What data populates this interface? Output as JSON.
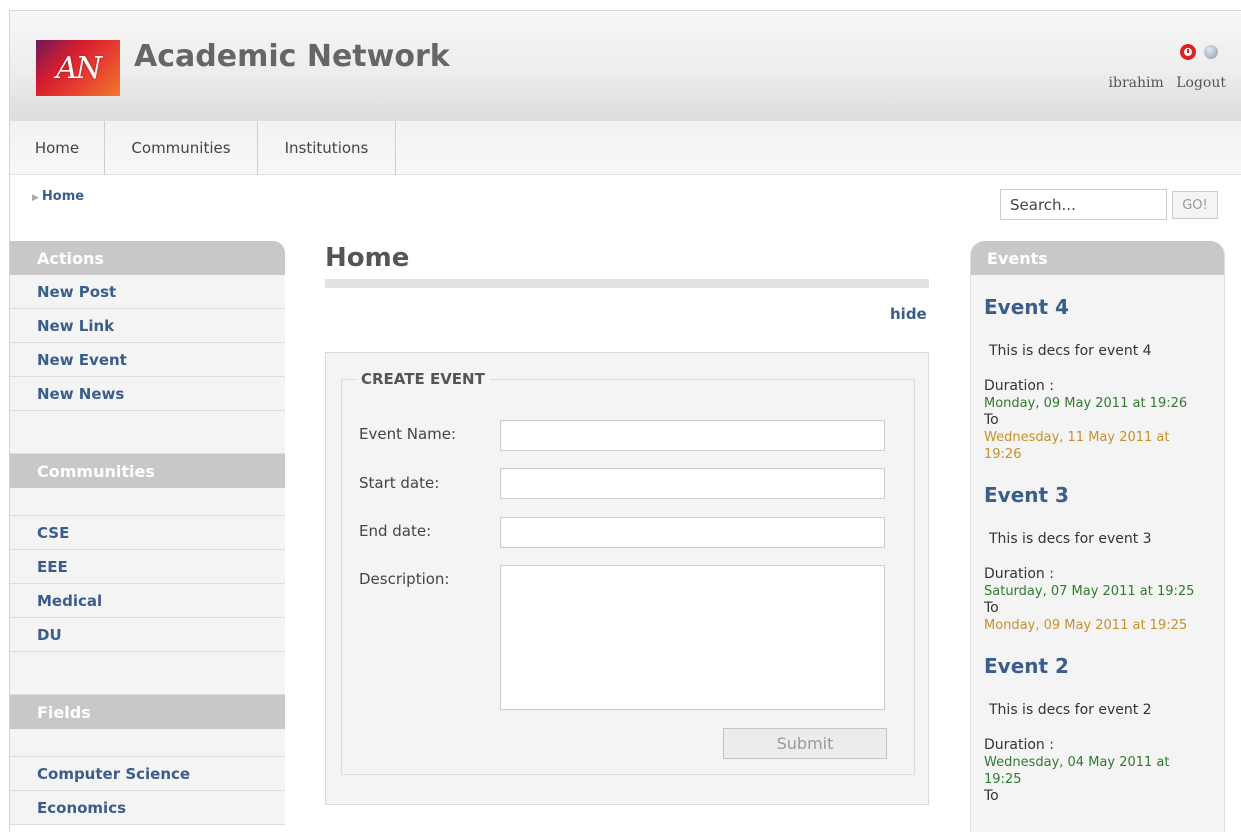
{
  "header": {
    "logo_text": "AN",
    "site_title": "Academic Network",
    "username": "ibrahim",
    "logout_label": "Logout"
  },
  "nav": [
    "Home",
    "Communities",
    "Institutions"
  ],
  "breadcrumb": {
    "current": "Home"
  },
  "search": {
    "placeholder": "Search...",
    "go_label": "GO!"
  },
  "sidebar": {
    "actions_title": "Actions",
    "actions": [
      "New Post",
      "New Link",
      "New Event",
      "New News"
    ],
    "communities_title": "Communities",
    "communities": [
      "CSE",
      "EEE",
      "Medical",
      "DU"
    ],
    "fields_title": "Fields",
    "fields": [
      "Computer Science",
      "Economics"
    ]
  },
  "main": {
    "title": "Home",
    "hide_label": "hide",
    "form": {
      "legend": "CREATE EVENT",
      "event_name_label": "Event Name:",
      "start_date_label": "Start date:",
      "end_date_label": "End date:",
      "description_label": "Description:",
      "submit_label": "Submit"
    }
  },
  "events": {
    "title": "Events",
    "duration_label": "Duration :",
    "to_label": "To",
    "items": [
      {
        "name": "Event 4",
        "desc": "This is decs for event 4",
        "start": "Monday, 09 May 2011 at 19:26",
        "end": "Wednesday, 11 May 2011 at 19:26"
      },
      {
        "name": "Event 3",
        "desc": "This is decs for event 3",
        "start": "Saturday, 07 May 2011 at 19:25",
        "end": "Monday, 09 May 2011 at 19:25"
      },
      {
        "name": "Event 2",
        "desc": "This is decs for event 2",
        "start": "Wednesday, 04 May 2011 at 19:25",
        "end": ""
      }
    ]
  },
  "colors": {
    "link": "#3b5d8a",
    "start_date": "#2f7a2f",
    "end_date": "#c7902b",
    "panel_header": "#c8c8c8"
  }
}
